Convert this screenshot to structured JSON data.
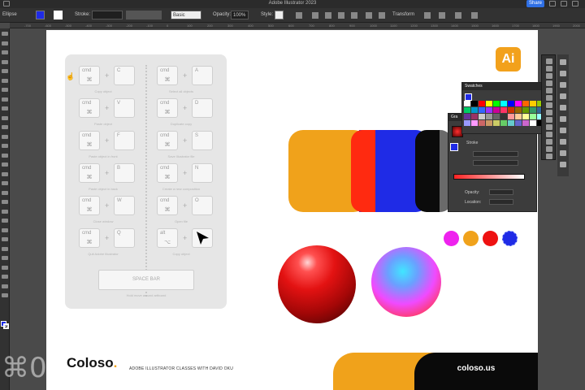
{
  "app": {
    "window_title": "Adobe Illustrator 2023",
    "share_label": "Share"
  },
  "control_bar": {
    "selection": "Ellipse",
    "stroke_label": "Stroke:",
    "brush_label": "Basic",
    "opacity_label": "Opacity:",
    "opacity_value": "100%",
    "style_label": "Style:",
    "transform_label": "Transform",
    "fill_color": "#1f2be6"
  },
  "ruler": {
    "ticks": [
      "-700",
      "-600",
      "-500",
      "-400",
      "-300",
      "-200",
      "-100",
      "0",
      "100",
      "200",
      "300",
      "400",
      "500",
      "600",
      "700",
      "800",
      "900",
      "1000",
      "1100",
      "1200",
      "1300",
      "1400",
      "1500",
      "1600",
      "1700",
      "1800",
      "1900",
      "2000"
    ]
  },
  "shortcuts": [
    {
      "key1": "cmd",
      "key2": "C",
      "caption": "Copy object"
    },
    {
      "key1": "cmd",
      "key2": "A",
      "caption": "Select all objects"
    },
    {
      "key1": "cmd",
      "key2": "V",
      "caption": "Paste object"
    },
    {
      "key1": "cmd",
      "key2": "D",
      "caption": "Duplicate copy"
    },
    {
      "key1": "cmd",
      "key2": "F",
      "caption": "Paste object in front"
    },
    {
      "key1": "cmd",
      "key2": "S",
      "caption": "Save Illustrator file"
    },
    {
      "key1": "cmd",
      "key2": "B",
      "caption": "Paste object in back"
    },
    {
      "key1": "cmd",
      "key2": "N",
      "caption": "Create a new composition"
    },
    {
      "key1": "cmd",
      "key2": "W",
      "caption": "Close window"
    },
    {
      "key1": "cmd",
      "key2": "O",
      "caption": "Open file"
    },
    {
      "key1": "cmd",
      "key2": "Q",
      "caption": "Quit Adobe Illustrator"
    },
    {
      "key1": "alt",
      "key2": "",
      "caption": "Copy object"
    }
  ],
  "cmd_symbol": "⌘",
  "alt_symbol": "⌥",
  "plus": "+",
  "spacebar": {
    "label": "SPACE BAR",
    "caption": "Hold move around artboard"
  },
  "ai_logo": "Ai",
  "panels": {
    "swatches_title": "Swatches",
    "gradient_title": "Gra",
    "stroke_label": "Stroke",
    "opacity_label": "Opacity:",
    "location_label": "Location:"
  },
  "colors": {
    "orange": "#f0a21b",
    "red": "#ff2a10",
    "blue": "#1f2be6",
    "black": "#0b0b0b",
    "magenta": "#ee22ee",
    "dot_red": "#ee1111",
    "dot_blue": "#1f2be6"
  },
  "footer": {
    "brand": "Coloso",
    "brand_dot": ".",
    "tagline": "ADOBE ILLUSTRATOR CLASSES WITH DAVID OKU",
    "url": "coloso.us"
  },
  "watermark": "⌘0"
}
